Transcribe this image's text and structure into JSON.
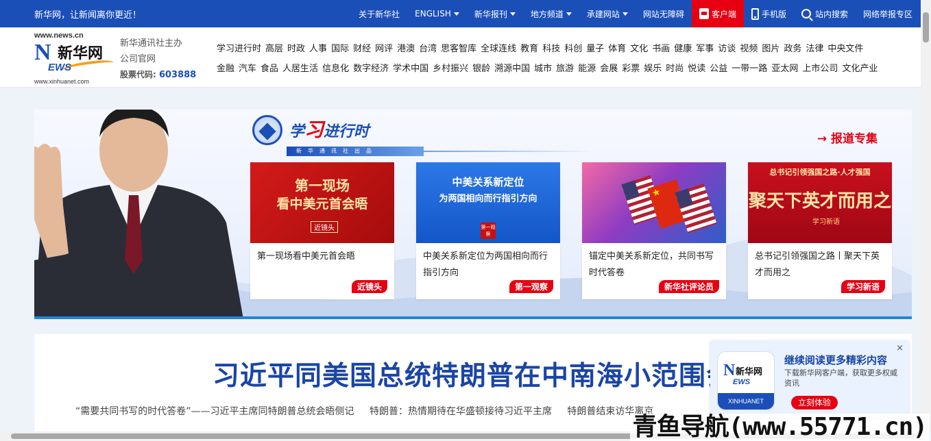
{
  "topbar": {
    "slogan": "新华网，让新闻离你更近！",
    "items": [
      {
        "label": "关于新华社"
      },
      {
        "label": "ENGLISH"
      },
      {
        "label": "新华报刊"
      },
      {
        "label": "地方频道"
      },
      {
        "label": "承建网站"
      },
      {
        "label": "网站无障碍"
      },
      {
        "label": "客户端"
      },
      {
        "label": "手机版"
      },
      {
        "label": "站内搜索"
      },
      {
        "label": "网络举报专区"
      }
    ]
  },
  "logo": {
    "url_top": "www.news.cn",
    "url_bottom": "www.xinhuanet.com",
    "big_letter": "N",
    "ews": "EWS",
    "cn_name": "新华网"
  },
  "org": {
    "line1": "新华通讯社主办",
    "line2": "公司官网",
    "stock_label": "股票代码:",
    "stock_code": "603888"
  },
  "catnav": {
    "row1": [
      "学习进行时",
      "高层",
      "时政",
      "人事",
      "国际",
      "财经",
      "网评",
      "港澳",
      "台湾",
      "思客智库",
      "全球连线",
      "教育",
      "科技",
      "科创",
      "量子",
      "体育",
      "文化",
      "书画",
      "健康",
      "军事",
      "访谈",
      "视频",
      "图片",
      "政务",
      "法律",
      "中央文件"
    ],
    "row2": [
      "金融",
      "汽车",
      "食品",
      "人居生活",
      "信息化",
      "数字经济",
      "学术中国",
      "乡村振兴",
      "银龄",
      "溯源中国",
      "城市",
      "旅游",
      "能源",
      "会展",
      "彩票",
      "娱乐",
      "时尚",
      "悦读",
      "公益",
      "一带一路",
      "亚太网",
      "上市公司",
      "文化产业"
    ]
  },
  "banner": {
    "study_title_a": "学",
    "study_title_b": "习",
    "study_title_c": "进行时",
    "study_sub": "新华通讯社出品",
    "special_link": "→ 报道专集",
    "cards": [
      {
        "thumb_line1": "第一现场",
        "thumb_line2": "看中美元首会晤",
        "thumb_badge": "近镜头",
        "title": "第一现场看中美元首会晤",
        "tag": "近镜头"
      },
      {
        "thumb_line1": "中美关系新定位",
        "thumb_line2": "为两国相向而行指引方向",
        "thumb_badge": "第一观察",
        "title": "中美关系新定位为两国相向而行指引方向",
        "tag": "第一观察"
      },
      {
        "title": "锚定中美关系新定位，共同书写时代答卷",
        "tag": "新华社评论员"
      },
      {
        "thumb_line1": "总书记引领强国之路·人才强国",
        "thumb_line2": "聚天下英才而用之",
        "thumb_badge": "学习新语",
        "title": "总书记引领强国之路丨聚天下英才而用之",
        "tag": "学习新语"
      }
    ]
  },
  "headline": {
    "title": "习近平同美国总统特朗普在中南海小范围会",
    "subs": [
      "“需要共同书写的时代答卷”——习近平主席同特朗普总统会晤侧记",
      "特朗普：热情期待在华盛顿接待习近平主席",
      "特朗普结束访华离京"
    ]
  },
  "popup": {
    "title": "继续阅读更多精彩内容",
    "desc": "下载新华网客户端，获取更多权威资讯",
    "button": "立刻体验",
    "close": "×",
    "app_n": "N",
    "app_cn": "新华网",
    "app_ews": "EWS",
    "app_foot": "XINHUANET"
  },
  "watermark": "青鱼导航(www.55771.cn)",
  "colors": {
    "brand_blue": "#1b4fb8",
    "accent_red": "#e60012",
    "headline_blue": "#1a45a6"
  }
}
